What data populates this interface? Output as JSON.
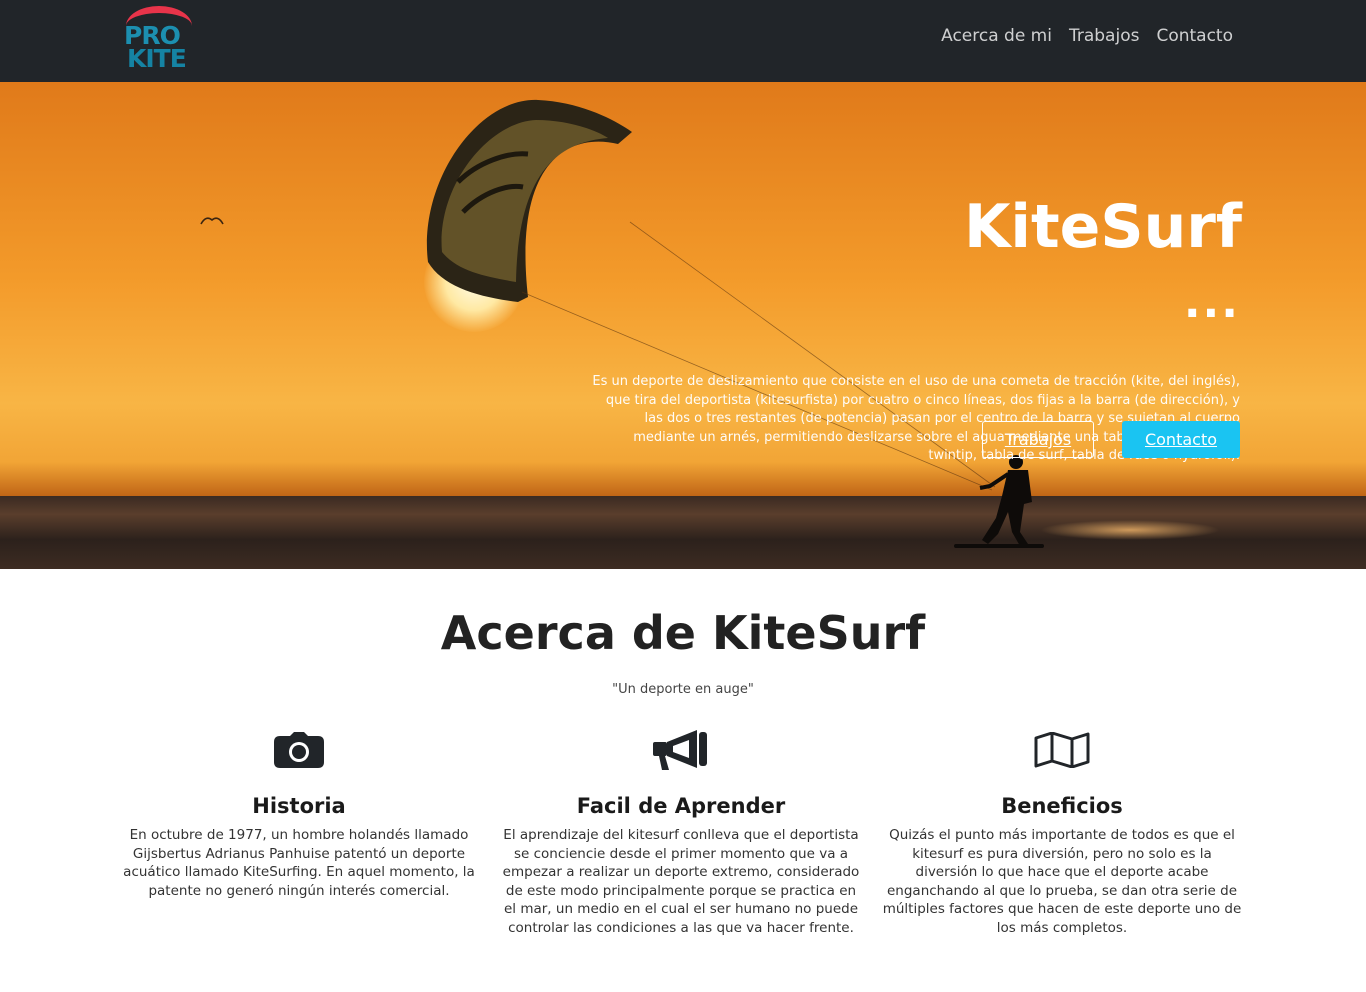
{
  "brand": {
    "logo_line1": "PRO",
    "logo_line2": "KITE",
    "colors": {
      "red": "#e8344a",
      "teal": "#1c8fb0",
      "navbar": "#212529",
      "accent": "#1ac4f2"
    }
  },
  "nav": {
    "items": [
      {
        "label": "Acerca de mi"
      },
      {
        "label": "Trabajos"
      },
      {
        "label": "Contacto"
      }
    ]
  },
  "hero": {
    "title": "KiteSurf",
    "dots": "...",
    "description": "Es un deporte de deslizamiento que consiste en el uso de una cometa de tracción (kite, del inglés), que tira del deportista (kitesurfista) por cuatro o cinco líneas, dos fijas a la barra (de dirección), y las dos o tres restantes (de potencia) pasan por el centro de la barra y se sujetan al cuerpo mediante un arnés, permitiendo deslizarse sobre el agua mediante una tabla (bidireccional o twintip, tabla de surf, tabla de race o hydrofoil).",
    "btn_trabajos": "Trabajos",
    "btn_contacto": "Contacto"
  },
  "about": {
    "title": "Acerca de KiteSurf",
    "subtitle": "\"Un deporte en auge\"",
    "features": [
      {
        "icon": "camera-icon",
        "title": "Historia",
        "text": "En octubre de 1977, un hombre holandés llamado Gijsbertus Adrianus Panhuise patentó un deporte acuático llamado KiteSurfing. En aquel momento, la patente no generó ningún interés comercial."
      },
      {
        "icon": "bullhorn-icon",
        "title": "Facil de Aprender",
        "text": "El aprendizaje del kitesurf conlleva que el deportista se conciencie desde el primer momento que va a empezar a realizar un deporte extremo, considerado de este modo principalmente porque se practica en el mar, un medio en el cual el ser humano no puede controlar las condiciones a las que va hacer frente."
      },
      {
        "icon": "map-icon",
        "title": "Beneficios",
        "text": "Quizás el punto más importante de todos es que el kitesurf es pura diversión, pero no solo es la diversión lo que hace que el deporte acabe enganchando al que lo prueba, se dan otra serie de múltiples factores que hacen de este deporte uno de los más completos."
      }
    ]
  }
}
